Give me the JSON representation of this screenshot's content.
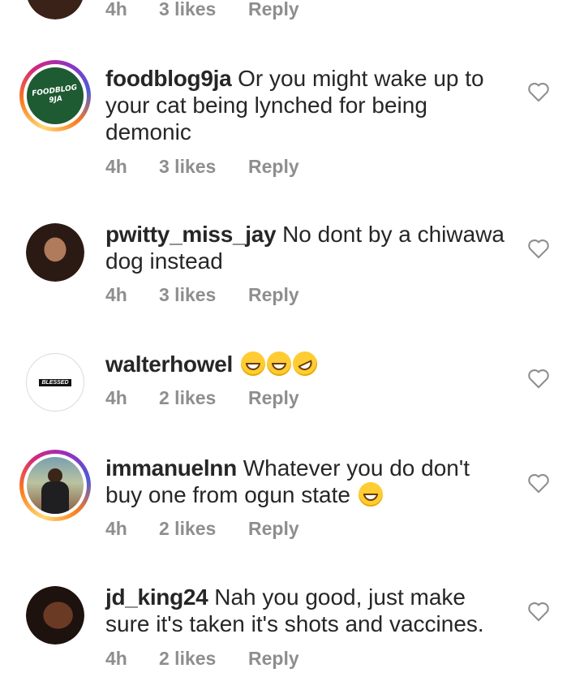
{
  "comments": [
    {
      "username": "",
      "text": "",
      "time": "4h",
      "likes": "3 likes",
      "reply": "Reply"
    },
    {
      "username": "foodblog9ja",
      "text": "Or you might wake up to your cat being lynched for being demonic",
      "time": "4h",
      "likes": "3 likes",
      "reply": "Reply",
      "avatar_text": "FOODBLOG 9JA"
    },
    {
      "username": "pwitty_miss_jay",
      "text": "No dont by a chiwawa dog instead",
      "time": "4h",
      "likes": "3 likes",
      "reply": "Reply"
    },
    {
      "username": "walterhowel",
      "text": "",
      "time": "4h",
      "likes": "2 likes",
      "reply": "Reply",
      "avatar_text": "BLESSED",
      "emojis": [
        "grin-squint-emoji",
        "grin-squint-emoji",
        "rofl-emoji"
      ]
    },
    {
      "username": "immanuelnn",
      "text": "Whatever you do don't buy one from ogun state",
      "time": "4h",
      "likes": "2 likes",
      "reply": "Reply",
      "emojis": [
        "grin-squint-emoji"
      ]
    },
    {
      "username": "jd_king24",
      "text": "Nah you good, just make sure it's taken it's shots and vaccines.",
      "time": "4h",
      "likes": "2 likes",
      "reply": "Reply"
    }
  ],
  "colors": {
    "text": "#262626",
    "meta": "#8e8e8e",
    "foodblog_green": "#1e5a32"
  },
  "icons": {
    "like": "heart-outline-icon"
  }
}
